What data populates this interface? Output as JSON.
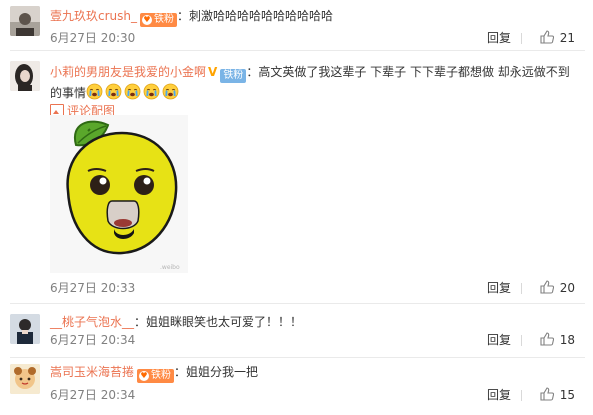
{
  "comments": [
    {
      "user": "壹九玖玖crush_",
      "badge": "铁粉",
      "colon": "：",
      "text": "刺激哈哈哈哈哈哈哈哈哈哈",
      "time": "6月27日 20:30",
      "reply": "回复",
      "likes": "21"
    },
    {
      "user": "小莉的男朋友是我爱的小金啊",
      "badge": "铁粉",
      "verified": "V",
      "colon": "：",
      "text": "高文英做了我这辈子  下辈子  下下辈子都想做 却永远做不到的事情",
      "emoji_name": "crying-face-emoji",
      "emoji_count": 5,
      "comment_pic": "评论配图",
      "time": "6月27日 20:33",
      "reply": "回复",
      "likes": "20"
    },
    {
      "user": "__桃子气泡水__",
      "colon": "：",
      "text": "姐姐眯眼笑也太可爱了！！！",
      "time": "6月27日 20:34",
      "reply": "回复",
      "likes": "18"
    },
    {
      "user": "嵩司玉米海苔捲",
      "badge": "铁粉",
      "colon": "：",
      "text": "姐姐分我一把",
      "time": "6月27日 20:34",
      "reply": "回复",
      "likes": "15"
    }
  ],
  "colors": {
    "username": "#eb7350",
    "badge_orange": "#ff8a44",
    "badge_blue": "#7ab4e6",
    "verified": "#ffa300",
    "meta": "#808080"
  },
  "icons": [
    "thumbs-up-icon",
    "picture-icon",
    "crying-face-emoji",
    "lemon-sticker"
  ]
}
